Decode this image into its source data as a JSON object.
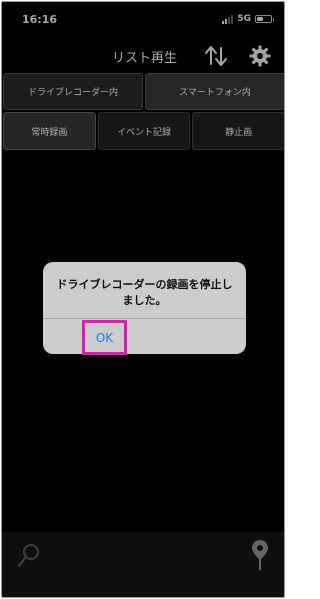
{
  "status": {
    "time": "16:16",
    "network": "5G"
  },
  "header": {
    "title": "リスト再生",
    "sort_icon": "sort-arrows-icon",
    "settings_icon": "gear-icon"
  },
  "source_tabs": [
    {
      "label": "ドライブレコーダー内",
      "selected": true
    },
    {
      "label": "スマートフォン内",
      "selected": false
    }
  ],
  "category_tabs": [
    {
      "label": "常時録画",
      "selected": true
    },
    {
      "label": "イベント記録",
      "selected": false
    },
    {
      "label": "静止画",
      "selected": false
    }
  ],
  "alert": {
    "message": "ドライブレコーダーの録画を停止しました。",
    "ok_label": "OK",
    "highlight_color": "#e31ab8"
  },
  "toolbar": {
    "search_icon": "search-icon",
    "location_icon": "map-pin-icon"
  },
  "colors": {
    "background": "#000000",
    "accent": "#1f7ee8"
  }
}
